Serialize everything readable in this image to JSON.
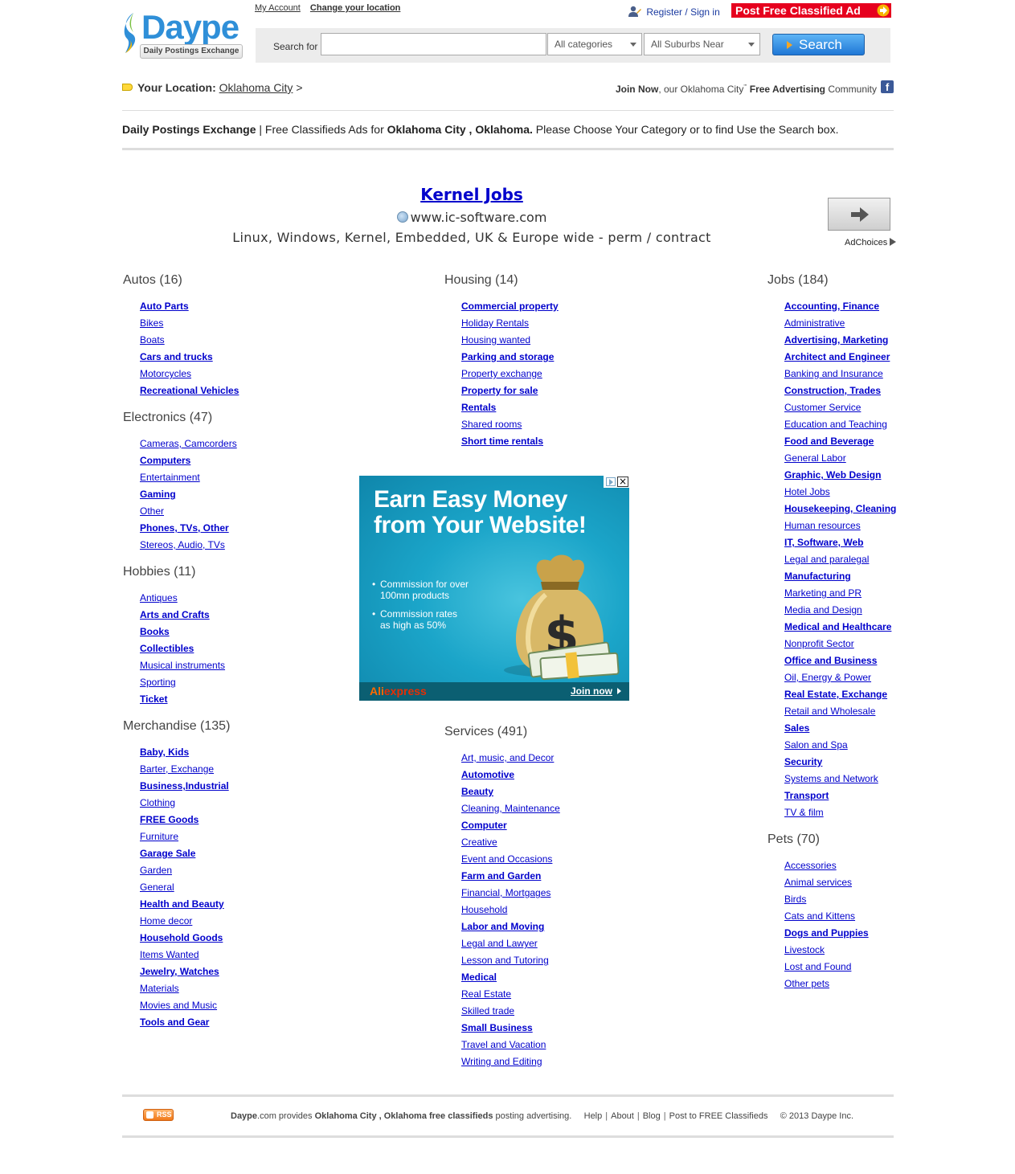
{
  "brand": {
    "logo_word": "Daype",
    "logo_tagline": "Daily Postings Exchange"
  },
  "top_links": {
    "my_account": "My Account",
    "change_location": "Change your location"
  },
  "account": {
    "register": "Register",
    "slash": "/",
    "signin": "Sign in"
  },
  "post_ad": "Post Free Classified Ad",
  "search": {
    "label": "Search for",
    "value": "",
    "category": "All categories",
    "suburb": "All Suburbs Near",
    "button": "Search"
  },
  "location": {
    "label": "Your Location:",
    "city": "Oklahoma City",
    "arrow": ">"
  },
  "join": {
    "pre": "Join Now",
    "mid": ", our ",
    "city": "Oklahoma City",
    "sup": "'''",
    "post1": "Free Advertising",
    "post2": " Community"
  },
  "intro": {
    "brand": "Daily Postings Exchange",
    "sep": " | Free Classifieds Ads for ",
    "place": "Oklahoma City , Oklahoma.",
    "rest": " Please Choose Your Category or to find Use the Search box."
  },
  "text_ad": {
    "title": "Kernel Jobs",
    "url": "www.ic-software.com",
    "desc": "Linux, Windows, Kernel, Embedded, UK & Europe wide - perm / contract",
    "adchoices": "AdChoices"
  },
  "categories": {
    "autos": {
      "title": "Autos (16)",
      "items": [
        {
          "label": "Auto Parts",
          "bold": true
        },
        {
          "label": "Bikes",
          "bold": false
        },
        {
          "label": "Boats",
          "bold": false
        },
        {
          "label": "Cars and trucks",
          "bold": true
        },
        {
          "label": "Motorcycles",
          "bold": false
        },
        {
          "label": "Recreational Vehicles",
          "bold": true
        }
      ]
    },
    "electronics": {
      "title": "Electronics (47)",
      "items": [
        {
          "label": "Cameras, Camcorders",
          "bold": false
        },
        {
          "label": "Computers",
          "bold": true
        },
        {
          "label": "Entertainment",
          "bold": false
        },
        {
          "label": "Gaming",
          "bold": true
        },
        {
          "label": "Other",
          "bold": false
        },
        {
          "label": "Phones, TVs, Other",
          "bold": true
        },
        {
          "label": "Stereos, Audio, TVs",
          "bold": false
        }
      ]
    },
    "hobbies": {
      "title": "Hobbies (11)",
      "items": [
        {
          "label": "Antiques",
          "bold": false
        },
        {
          "label": "Arts and Crafts",
          "bold": true
        },
        {
          "label": "Books",
          "bold": true
        },
        {
          "label": "Collectibles",
          "bold": true
        },
        {
          "label": "Musical instruments",
          "bold": false
        },
        {
          "label": "Sporting",
          "bold": false
        },
        {
          "label": "Ticket",
          "bold": true
        }
      ]
    },
    "merchandise": {
      "title": "Merchandise (135)",
      "items": [
        {
          "label": "Baby, Kids",
          "bold": true
        },
        {
          "label": "Barter, Exchange",
          "bold": false
        },
        {
          "label": "Business,Industrial",
          "bold": true
        },
        {
          "label": "Clothing",
          "bold": false
        },
        {
          "label": "FREE Goods",
          "bold": true
        },
        {
          "label": "Furniture",
          "bold": false
        },
        {
          "label": "Garage Sale",
          "bold": true
        },
        {
          "label": "Garden",
          "bold": false
        },
        {
          "label": "General",
          "bold": false
        },
        {
          "label": "Health and Beauty",
          "bold": true
        },
        {
          "label": "Home decor",
          "bold": false
        },
        {
          "label": "Household Goods",
          "bold": true
        },
        {
          "label": "Items Wanted",
          "bold": false
        },
        {
          "label": "Jewelry, Watches",
          "bold": true
        },
        {
          "label": "Materials",
          "bold": false
        },
        {
          "label": "Movies and Music",
          "bold": false
        },
        {
          "label": "Tools and Gear",
          "bold": true
        }
      ]
    },
    "housing": {
      "title": "Housing (14)",
      "items": [
        {
          "label": "Commercial property",
          "bold": true
        },
        {
          "label": "Holiday Rentals",
          "bold": false
        },
        {
          "label": "Housing wanted",
          "bold": false
        },
        {
          "label": "Parking and storage",
          "bold": true
        },
        {
          "label": "Property exchange",
          "bold": false
        },
        {
          "label": "Property for sale",
          "bold": true
        },
        {
          "label": "Rentals",
          "bold": true
        },
        {
          "label": "Shared rooms",
          "bold": false
        },
        {
          "label": "Short time rentals",
          "bold": true
        }
      ]
    },
    "services": {
      "title": "Services (491)",
      "items": [
        {
          "label": "Art, music, and Decor",
          "bold": false
        },
        {
          "label": "Automotive",
          "bold": true
        },
        {
          "label": "Beauty",
          "bold": true
        },
        {
          "label": "Cleaning, Maintenance",
          "bold": false
        },
        {
          "label": "Computer",
          "bold": true
        },
        {
          "label": "Creative",
          "bold": false
        },
        {
          "label": "Event and Occasions",
          "bold": false
        },
        {
          "label": "Farm and Garden",
          "bold": true
        },
        {
          "label": "Financial, Mortgages",
          "bold": false
        },
        {
          "label": "Household",
          "bold": false
        },
        {
          "label": "Labor and Moving",
          "bold": true
        },
        {
          "label": "Legal and Lawyer",
          "bold": false
        },
        {
          "label": "Lesson and Tutoring",
          "bold": false
        },
        {
          "label": "Medical",
          "bold": true
        },
        {
          "label": "Real Estate",
          "bold": false
        },
        {
          "label": "Skilled trade",
          "bold": false
        },
        {
          "label": "Small Business",
          "bold": true
        },
        {
          "label": "Travel and Vacation",
          "bold": false
        },
        {
          "label": "Writing and Editing",
          "bold": false
        }
      ]
    },
    "jobs": {
      "title": "Jobs (184)",
      "items": [
        {
          "label": "Accounting, Finance",
          "bold": true
        },
        {
          "label": "Administrative",
          "bold": false
        },
        {
          "label": "Advertising, Marketing",
          "bold": true
        },
        {
          "label": "Architect and Engineer",
          "bold": true
        },
        {
          "label": "Banking and Insurance",
          "bold": false
        },
        {
          "label": "Construction, Trades",
          "bold": true
        },
        {
          "label": "Customer Service",
          "bold": false
        },
        {
          "label": "Education and Teaching",
          "bold": false
        },
        {
          "label": "Food and Beverage",
          "bold": true
        },
        {
          "label": "General Labor",
          "bold": false
        },
        {
          "label": "Graphic, Web Design",
          "bold": true
        },
        {
          "label": "Hotel Jobs",
          "bold": false
        },
        {
          "label": "Housekeeping, Cleaning",
          "bold": true
        },
        {
          "label": "Human resources",
          "bold": false
        },
        {
          "label": "IT, Software, Web",
          "bold": true
        },
        {
          "label": "Legal and paralegal",
          "bold": false
        },
        {
          "label": "Manufacturing",
          "bold": true
        },
        {
          "label": "Marketing and PR",
          "bold": false
        },
        {
          "label": "Media and Design",
          "bold": false
        },
        {
          "label": "Medical and Healthcare",
          "bold": true
        },
        {
          "label": "Nonprofit Sector",
          "bold": false
        },
        {
          "label": "Office and Business",
          "bold": true
        },
        {
          "label": "Oil, Energy & Power",
          "bold": false
        },
        {
          "label": "Real Estate, Exchange",
          "bold": true
        },
        {
          "label": "Retail and Wholesale",
          "bold": false
        },
        {
          "label": "Sales",
          "bold": true
        },
        {
          "label": "Salon and Spa",
          "bold": false
        },
        {
          "label": "Security",
          "bold": true
        },
        {
          "label": "Systems and Network",
          "bold": false
        },
        {
          "label": "Transport",
          "bold": true
        },
        {
          "label": "TV & film",
          "bold": false
        }
      ]
    },
    "pets": {
      "title": "Pets (70)",
      "items": [
        {
          "label": "Accessories",
          "bold": false
        },
        {
          "label": "Animal services",
          "bold": false
        },
        {
          "label": "Birds",
          "bold": false
        },
        {
          "label": "Cats and Kittens",
          "bold": false
        },
        {
          "label": "Dogs and Puppies",
          "bold": true
        },
        {
          "label": "Livestock",
          "bold": false
        },
        {
          "label": "Lost and Found",
          "bold": false
        },
        {
          "label": "Other pets",
          "bold": false
        }
      ]
    }
  },
  "banner": {
    "headline1": "Earn Easy Money",
    "headline2": "from Your Website!",
    "bullet1_l1": "Commission for over",
    "bullet1_l2": "100mn products",
    "bullet2_l1": "Commission rates",
    "bullet2_l2": "as high as 50%",
    "brand_a": "Ali",
    "brand_b": "express",
    "cta": "Join now"
  },
  "footer": {
    "rss": "RSS",
    "site": "Daype",
    "site_suffix": ".com provides ",
    "place": "Oklahoma City , Oklahoma free classifieds",
    "rest": " posting advertising.",
    "links": [
      "Help",
      "About",
      "Blog",
      "Post to FREE Classifieds"
    ],
    "copyright": "© 2013 Daype Inc."
  },
  "colors": {
    "link": "#0000cc",
    "accent_red": "#e6001e",
    "logo_blue": "#2f8fd8",
    "search_btn": "#1f77d6"
  }
}
